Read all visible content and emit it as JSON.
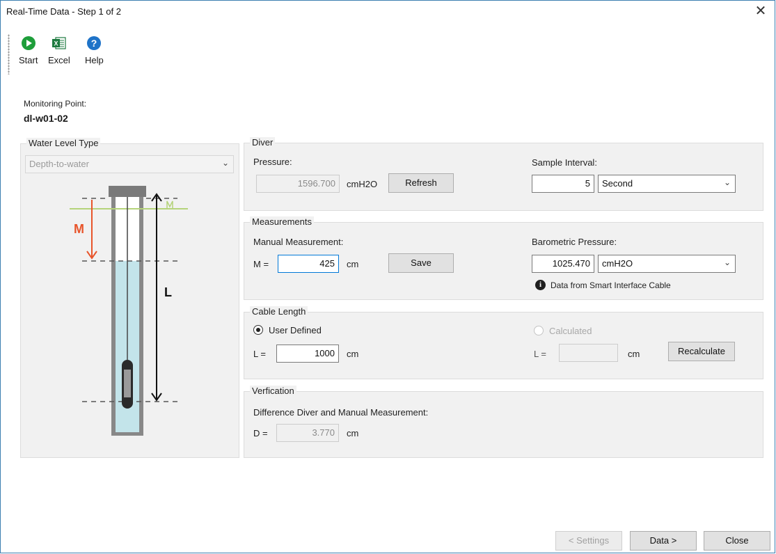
{
  "window": {
    "title": "Real-Time Data - Step 1 of 2",
    "close_glyph": "✕"
  },
  "toolbar": {
    "items": [
      {
        "label": "Start",
        "icon": "play-icon",
        "color": "#1e9e3a"
      },
      {
        "label": "Excel",
        "icon": "excel-icon",
        "color": "#1d7a3f"
      },
      {
        "label": "Help",
        "icon": "help-icon",
        "color": "#1e73c8"
      }
    ]
  },
  "monitoring_point": {
    "label": "Monitoring Point:",
    "value": "dl-w01-02"
  },
  "water_level": {
    "group_title": "Water Level Type",
    "selected": "Depth-to-water",
    "diagram": {
      "m_label": "M",
      "l_label": "L"
    }
  },
  "diver": {
    "group_title": "Diver",
    "pressure_label": "Pressure:",
    "pressure_value": "1596.700",
    "pressure_unit": "cmH2O",
    "refresh_label": "Refresh",
    "sample_interval_label": "Sample Interval:",
    "sample_interval_value": "5",
    "sample_interval_unit": "Second"
  },
  "measurements": {
    "group_title": "Measurements",
    "manual_label": "Manual Measurement:",
    "m_prefix": "M =",
    "m_value": "425",
    "m_unit": "cm",
    "save_label": "Save",
    "baro_label": "Barometric Pressure:",
    "baro_value": "1025.470",
    "baro_unit": "cmH2O",
    "info_text": "Data from Smart Interface Cable"
  },
  "cable_length": {
    "group_title": "Cable Length",
    "user_defined_label": "User Defined",
    "calculated_label": "Calculated",
    "l_prefix": "L =",
    "l_value": "1000",
    "l_unit": "cm",
    "calc_prefix": "L =",
    "calc_value": "",
    "calc_unit": "cm",
    "recalculate_label": "Recalculate"
  },
  "verification": {
    "group_title": "Verfication",
    "difference_label": "Difference Diver and Manual Measurement:",
    "d_prefix": "D =",
    "d_value": "3.770",
    "d_unit": "cm"
  },
  "footer": {
    "settings_label": "< Settings",
    "data_label": "Data >",
    "close_label": "Close"
  },
  "colors": {
    "accent": "#0078d7",
    "arrow_red": "#e8542a",
    "water": "#c3e4ea",
    "ground": "#b5d37a"
  }
}
